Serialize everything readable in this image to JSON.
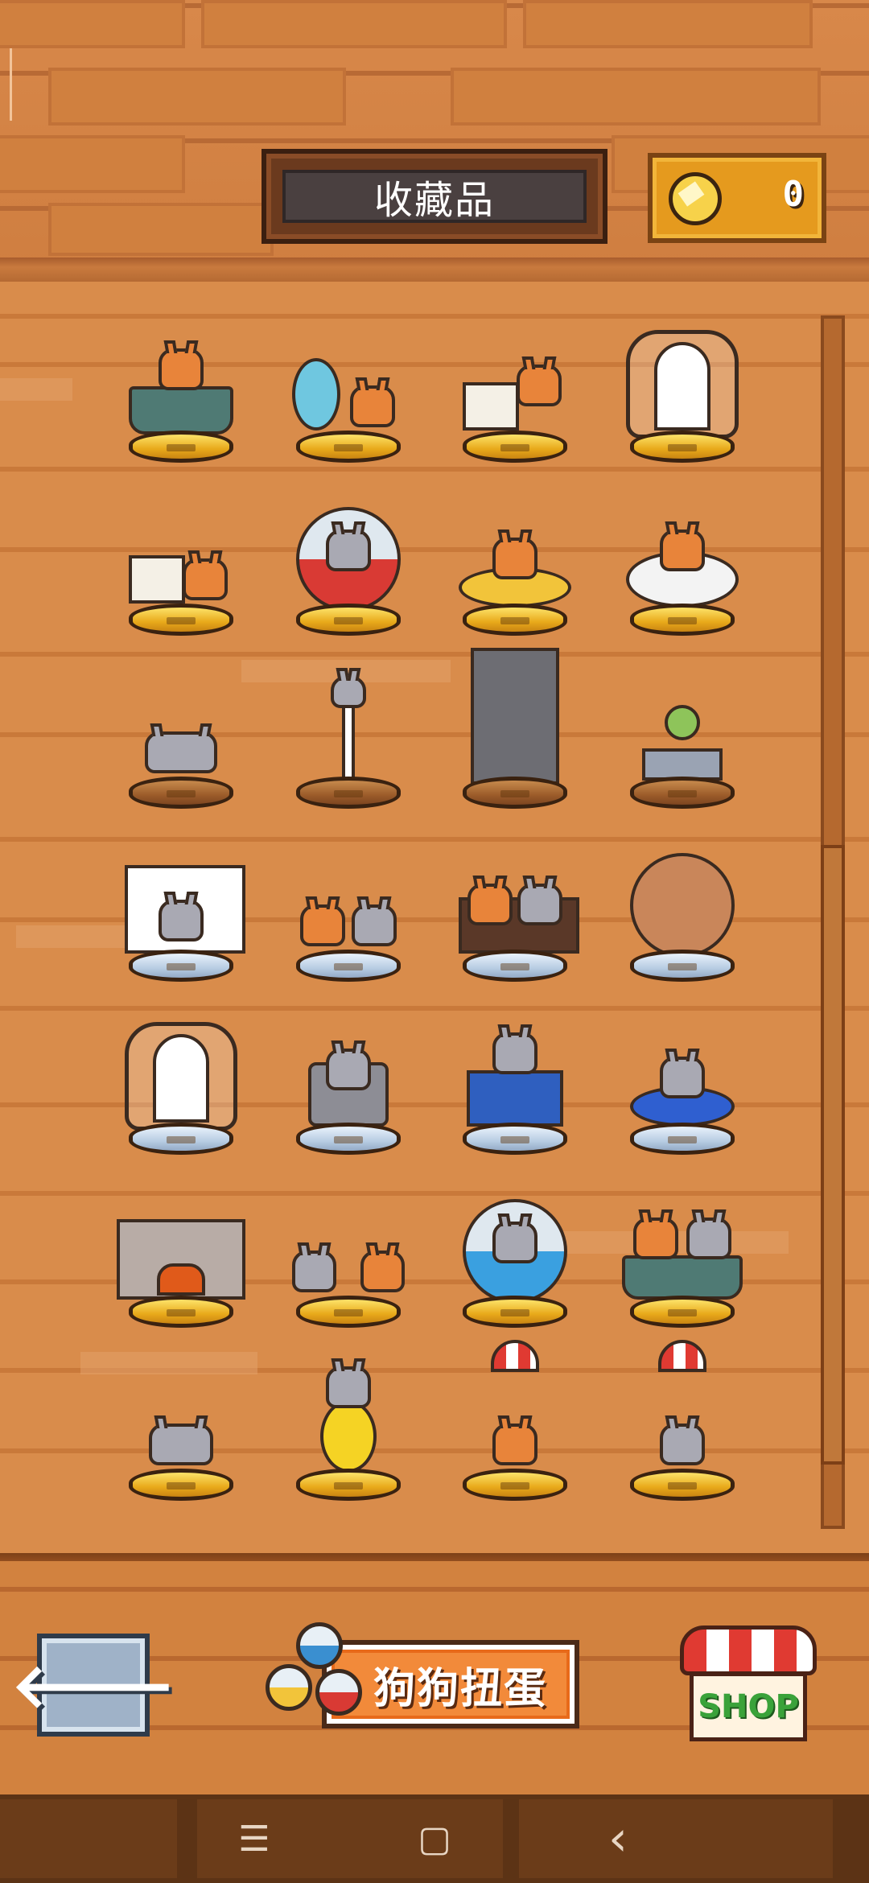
{
  "header": {
    "title": "收藏品",
    "coins": "0"
  },
  "collection": {
    "rows": [
      [
        "bathtub-gold",
        "mirror-gold",
        "dining-table-gold",
        "arched-door-gold"
      ],
      [
        "tea-cart-gold",
        "red-capsule-gold",
        "donut-bed-gold",
        "ball-pit-gold"
      ],
      [
        "husky-bronze",
        "coat-stand-bronze",
        "wardrobe-bronze",
        "potted-plant-bronze"
      ],
      [
        "window-silver",
        "two-dogs-silver",
        "sofa-silver",
        "round-window-silver"
      ],
      [
        "arched-door-silver",
        "armchair-silver",
        "computer-desk-silver",
        "blue-bed-silver"
      ],
      [
        "fireplace-gold",
        "dinner-date-gold",
        "blue-capsule-gold",
        "bathtub-two-gold"
      ],
      [
        "wizard-husky-gold",
        "moon-gold",
        "parachute-shiba-gold",
        "parachute-husky-gold"
      ]
    ]
  },
  "bottom": {
    "back_icon": "left-arrow-icon",
    "gacha_label": "狗狗扭蛋",
    "shop_label": "SHOP"
  },
  "system_nav": {
    "menu": "☰",
    "home": "▢",
    "back": "‹"
  },
  "colors": {
    "gold": "#e8a91a",
    "bronze": "#9c5c2a",
    "silver": "#b8cde3",
    "wood": "#d98c4b"
  }
}
